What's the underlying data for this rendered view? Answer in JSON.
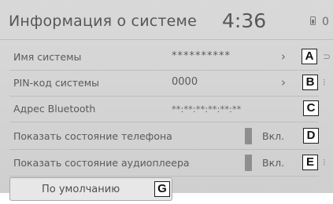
{
  "header": {
    "title": "Информация о системе",
    "clock": "4:36",
    "status_text": "0"
  },
  "rows": [
    {
      "label": "Имя системы",
      "value": "**********",
      "chevron": "›",
      "callout": "A"
    },
    {
      "label": "PIN-код системы",
      "value": "0000",
      "chevron": "›",
      "callout": "B"
    },
    {
      "label": "Адрес Bluetooth",
      "value": "**:**:**:**:**:**",
      "callout": "C"
    },
    {
      "label": "Показать состояние телефона",
      "toggle_label": "Вкл.",
      "callout": "D"
    },
    {
      "label": "Показать состояние аудиоплеера",
      "toggle_label": "Вкл.",
      "callout": "E"
    }
  ],
  "default_button": {
    "label": "По умолчанию",
    "callout": "G"
  },
  "icons": {
    "status": "phone-battery-icon",
    "chevron": "chevron-right-icon"
  },
  "colors": {
    "screen_bg": "#d5d5d5",
    "text": "#5a5a5a",
    "toggle_indicator": "#8e8e8e",
    "callout_border": "#1f1f1f"
  }
}
